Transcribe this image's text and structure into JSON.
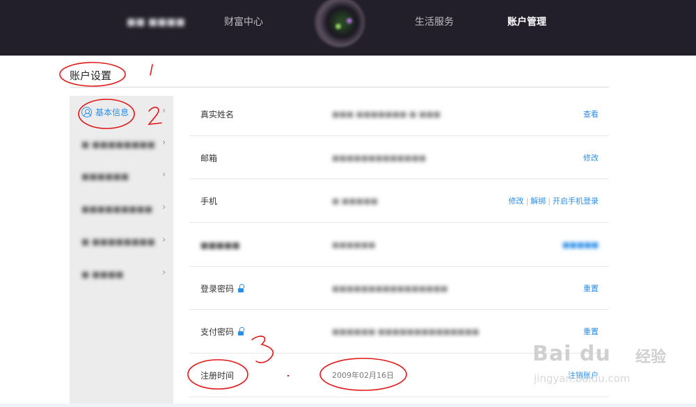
{
  "topnav": {
    "items": [
      {
        "label": "■■ ■■■■",
        "blurred": true
      },
      {
        "label": "财富中心",
        "blurred": false
      },
      {
        "label": "生活服务",
        "blurred": false
      },
      {
        "label": "账户管理",
        "blurred": false,
        "active": true
      }
    ]
  },
  "page": {
    "title": "账户设置"
  },
  "sidebar": {
    "items": [
      {
        "label": "基本信息",
        "active": true,
        "icon": "user-icon"
      },
      {
        "label": "■ ■■■■■■■■",
        "blurred": true
      },
      {
        "label": "■■■■■■",
        "blurred": true
      },
      {
        "label": "■■■■■■■■■",
        "blurred": true
      },
      {
        "label": "■ ■■■■■■■■",
        "blurred": true
      },
      {
        "label": "■ ■■■■",
        "blurred": true
      }
    ]
  },
  "rows": [
    {
      "label": "真实姓名",
      "value": "■■■ ■■■■■■■ ■ ■■■",
      "value_blurred": true,
      "actions": [
        "查看"
      ]
    },
    {
      "label": "邮箱",
      "value": "■■■■■■■■■■■■■",
      "value_blurred": true,
      "actions": [
        "修改"
      ]
    },
    {
      "label": "手机",
      "value": "■ ■■■■■",
      "value_blurred": true,
      "actions": [
        "修改",
        "解绑",
        "开启手机登录"
      ]
    },
    {
      "label": "■■■■■",
      "label_blurred": true,
      "value": "■■■■■■",
      "value_blurred": true,
      "actions": [
        "■■■■■"
      ],
      "actions_blurred": true
    },
    {
      "label": "登录密码",
      "lock": true,
      "value": "■■■■■■■■■■■■■■■■",
      "value_blurred": true,
      "actions": [
        "重置"
      ]
    },
    {
      "label": "支付密码",
      "lock": true,
      "value": "■■■■■■ ■■■■■■■■■■■■■■",
      "value_blurred": true,
      "actions": [
        "重置"
      ]
    },
    {
      "label": "注册时间",
      "value": "2009年02月16日",
      "value_blurred": false,
      "actions": [
        "注销账户"
      ]
    }
  ],
  "annotations": {
    "marks": [
      "1",
      "2",
      "3"
    ]
  },
  "watermark": {
    "brand": "Bai du",
    "site": "经验",
    "url": "jingyan.baidu.com"
  },
  "colors": {
    "nav_bg": "#231f2a",
    "accent": "#2b8ee8",
    "annotation": "#e01515",
    "sidebar_bg": "#ececec"
  }
}
